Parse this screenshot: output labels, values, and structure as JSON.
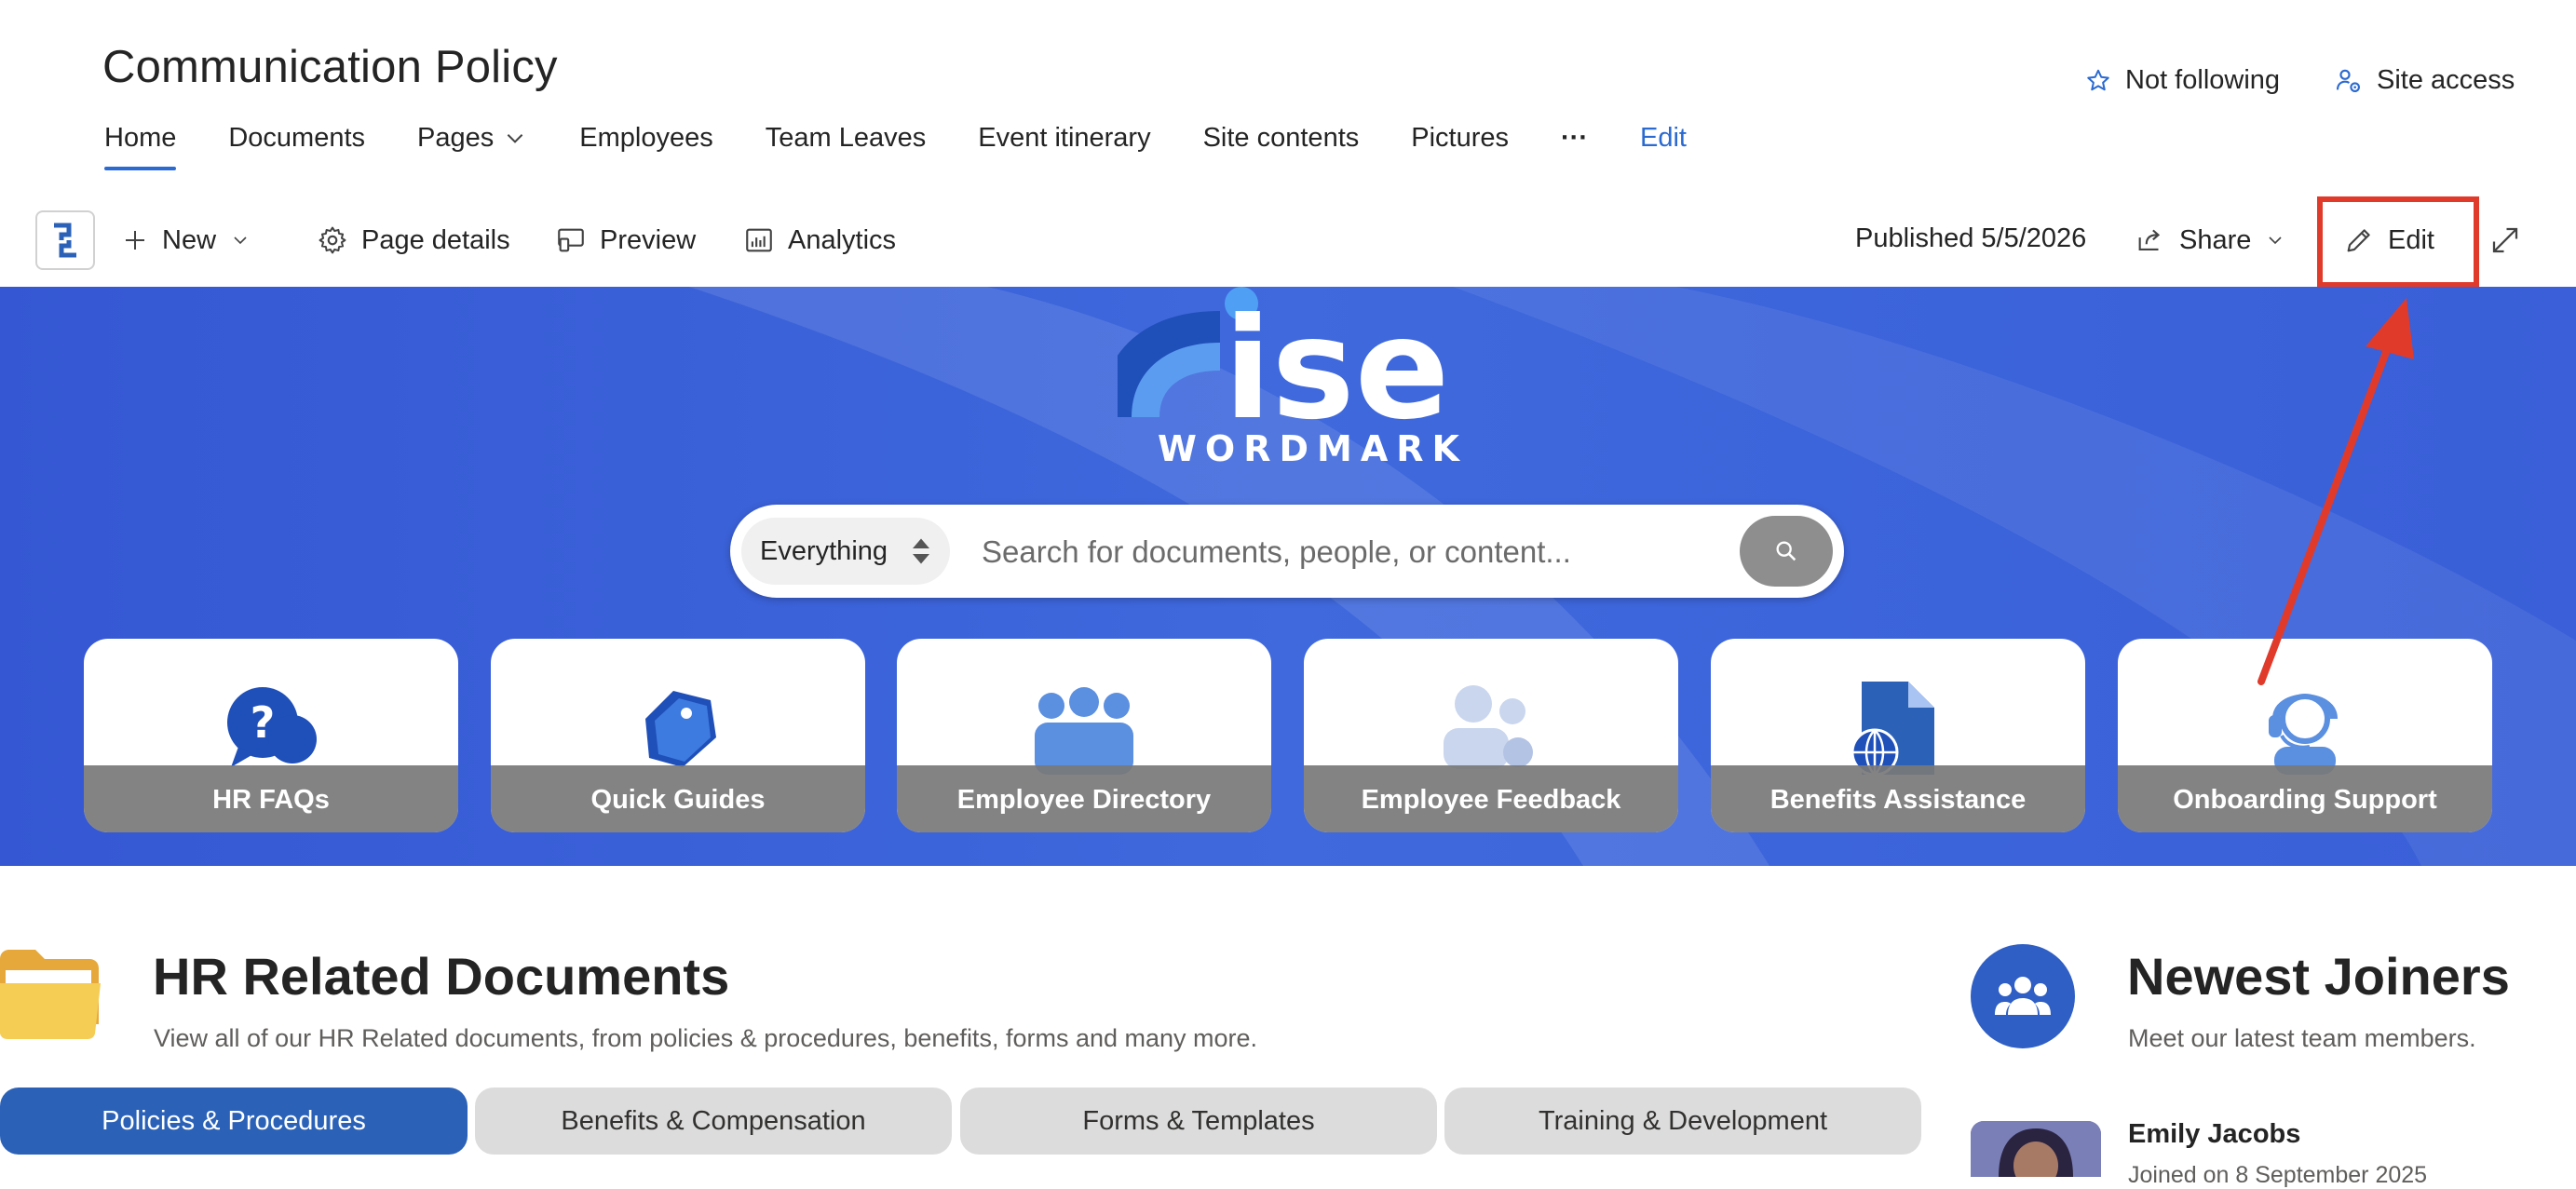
{
  "site": {
    "title": "Communication Policy",
    "nav": [
      {
        "label": "Home",
        "active": true
      },
      {
        "label": "Documents"
      },
      {
        "label": "Pages",
        "has_dropdown": true
      },
      {
        "label": "Employees"
      },
      {
        "label": "Team Leaves"
      },
      {
        "label": "Event itinerary"
      },
      {
        "label": "Site contents"
      },
      {
        "label": "Pictures"
      },
      {
        "label": "···"
      },
      {
        "label": "Edit"
      }
    ],
    "follow_label": "Not following",
    "site_access_label": "Site access"
  },
  "command_bar": {
    "new_label": "New",
    "page_details_label": "Page details",
    "preview_label": "Preview",
    "analytics_label": "Analytics",
    "published_label": "Published 5/5/2026",
    "share_label": "Share",
    "edit_label": "Edit"
  },
  "hero": {
    "logo_text": "ise",
    "logo_subtext": "WORDMARK",
    "search": {
      "scope_value": "Everything",
      "placeholder": "Search for documents, people, or content..."
    },
    "tiles": [
      {
        "label": "HR FAQs",
        "icon": "question-chat-icon"
      },
      {
        "label": "Quick Guides",
        "icon": "tag-icon"
      },
      {
        "label": "Employee Directory",
        "icon": "people-group-icon"
      },
      {
        "label": "Employee Feedback",
        "icon": "people-settings-icon"
      },
      {
        "label": "Benefits Assistance",
        "icon": "document-globe-icon"
      },
      {
        "label": "Onboarding Support",
        "icon": "person-headset-icon"
      }
    ]
  },
  "documents": {
    "title": "HR Related Documents",
    "description": "View all of our HR Related documents, from policies & procedures, benefits, forms and many more.",
    "tabs": [
      {
        "label": "Policies & Procedures",
        "active": true
      },
      {
        "label": "Benefits & Compensation"
      },
      {
        "label": "Forms & Templates"
      },
      {
        "label": "Training & Development"
      }
    ]
  },
  "joiners": {
    "title": "Newest Joiners",
    "description": "Meet our latest team members.",
    "people": [
      {
        "name": "Emily Jacobs",
        "subtitle": "Joined on 8 September 2025"
      }
    ]
  },
  "colors": {
    "accent": "#2b6ad1",
    "hero_bg": "#3a5fd8",
    "highlight_red": "#e03a2b",
    "active_tab": "#2b62b8"
  }
}
